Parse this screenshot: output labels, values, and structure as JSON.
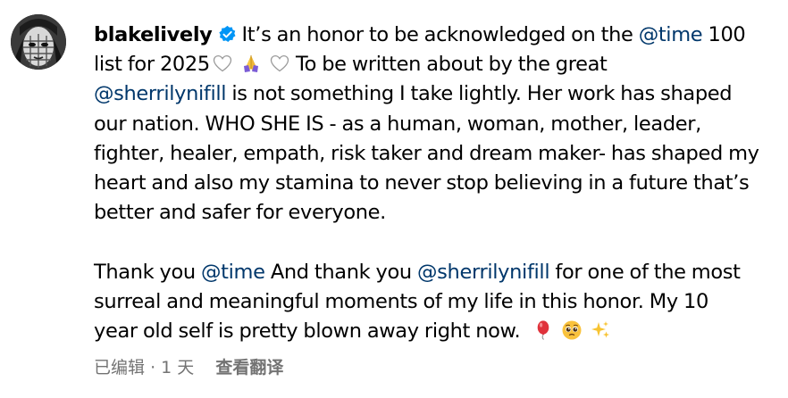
{
  "post": {
    "username": "blakelively",
    "verified": true,
    "segments": {
      "s1": "It’s an honor to be acknowledged on the ",
      "m_time_1": "@time",
      "s2": " 100",
      "s3": "list for 2025",
      "s4": " To be written about by the great",
      "m_sherrilyn_1": "@sherrilynifill",
      "s5": " is not something I take lightly. Her work has shaped",
      "s6": "our nation. WHO SHE IS - as a human, woman, mother, leader,",
      "s7": "fighter, healer, empath, risk taker and dream maker- has shaped my",
      "s8": "heart and also my stamina to never stop believing in a future that’s",
      "s9": "better and safer for everyone.",
      "s10": "Thank you ",
      "m_time_2": "@time",
      "s11": " And thank you ",
      "m_sherrilyn_2": "@sherrilynifill",
      "s12": " for one of the most",
      "s13": "surreal and meaningful moments of my life in this honor. My 10",
      "s14": "year old self is pretty blown away right now."
    },
    "emojis": [
      "white-heart-icon",
      "folded-hands-icon",
      "white-heart-icon",
      "balloon-icon",
      "pleading-face-icon",
      "sparkles-icon"
    ]
  },
  "meta": {
    "edited": "已编辑",
    "separator": "·",
    "time_ago": "1 天",
    "translate_label": "查看翻译"
  },
  "colors": {
    "text": "#000000",
    "mention": "#00376b",
    "secondary": "#737373",
    "verified_badge": "#0095f6"
  }
}
